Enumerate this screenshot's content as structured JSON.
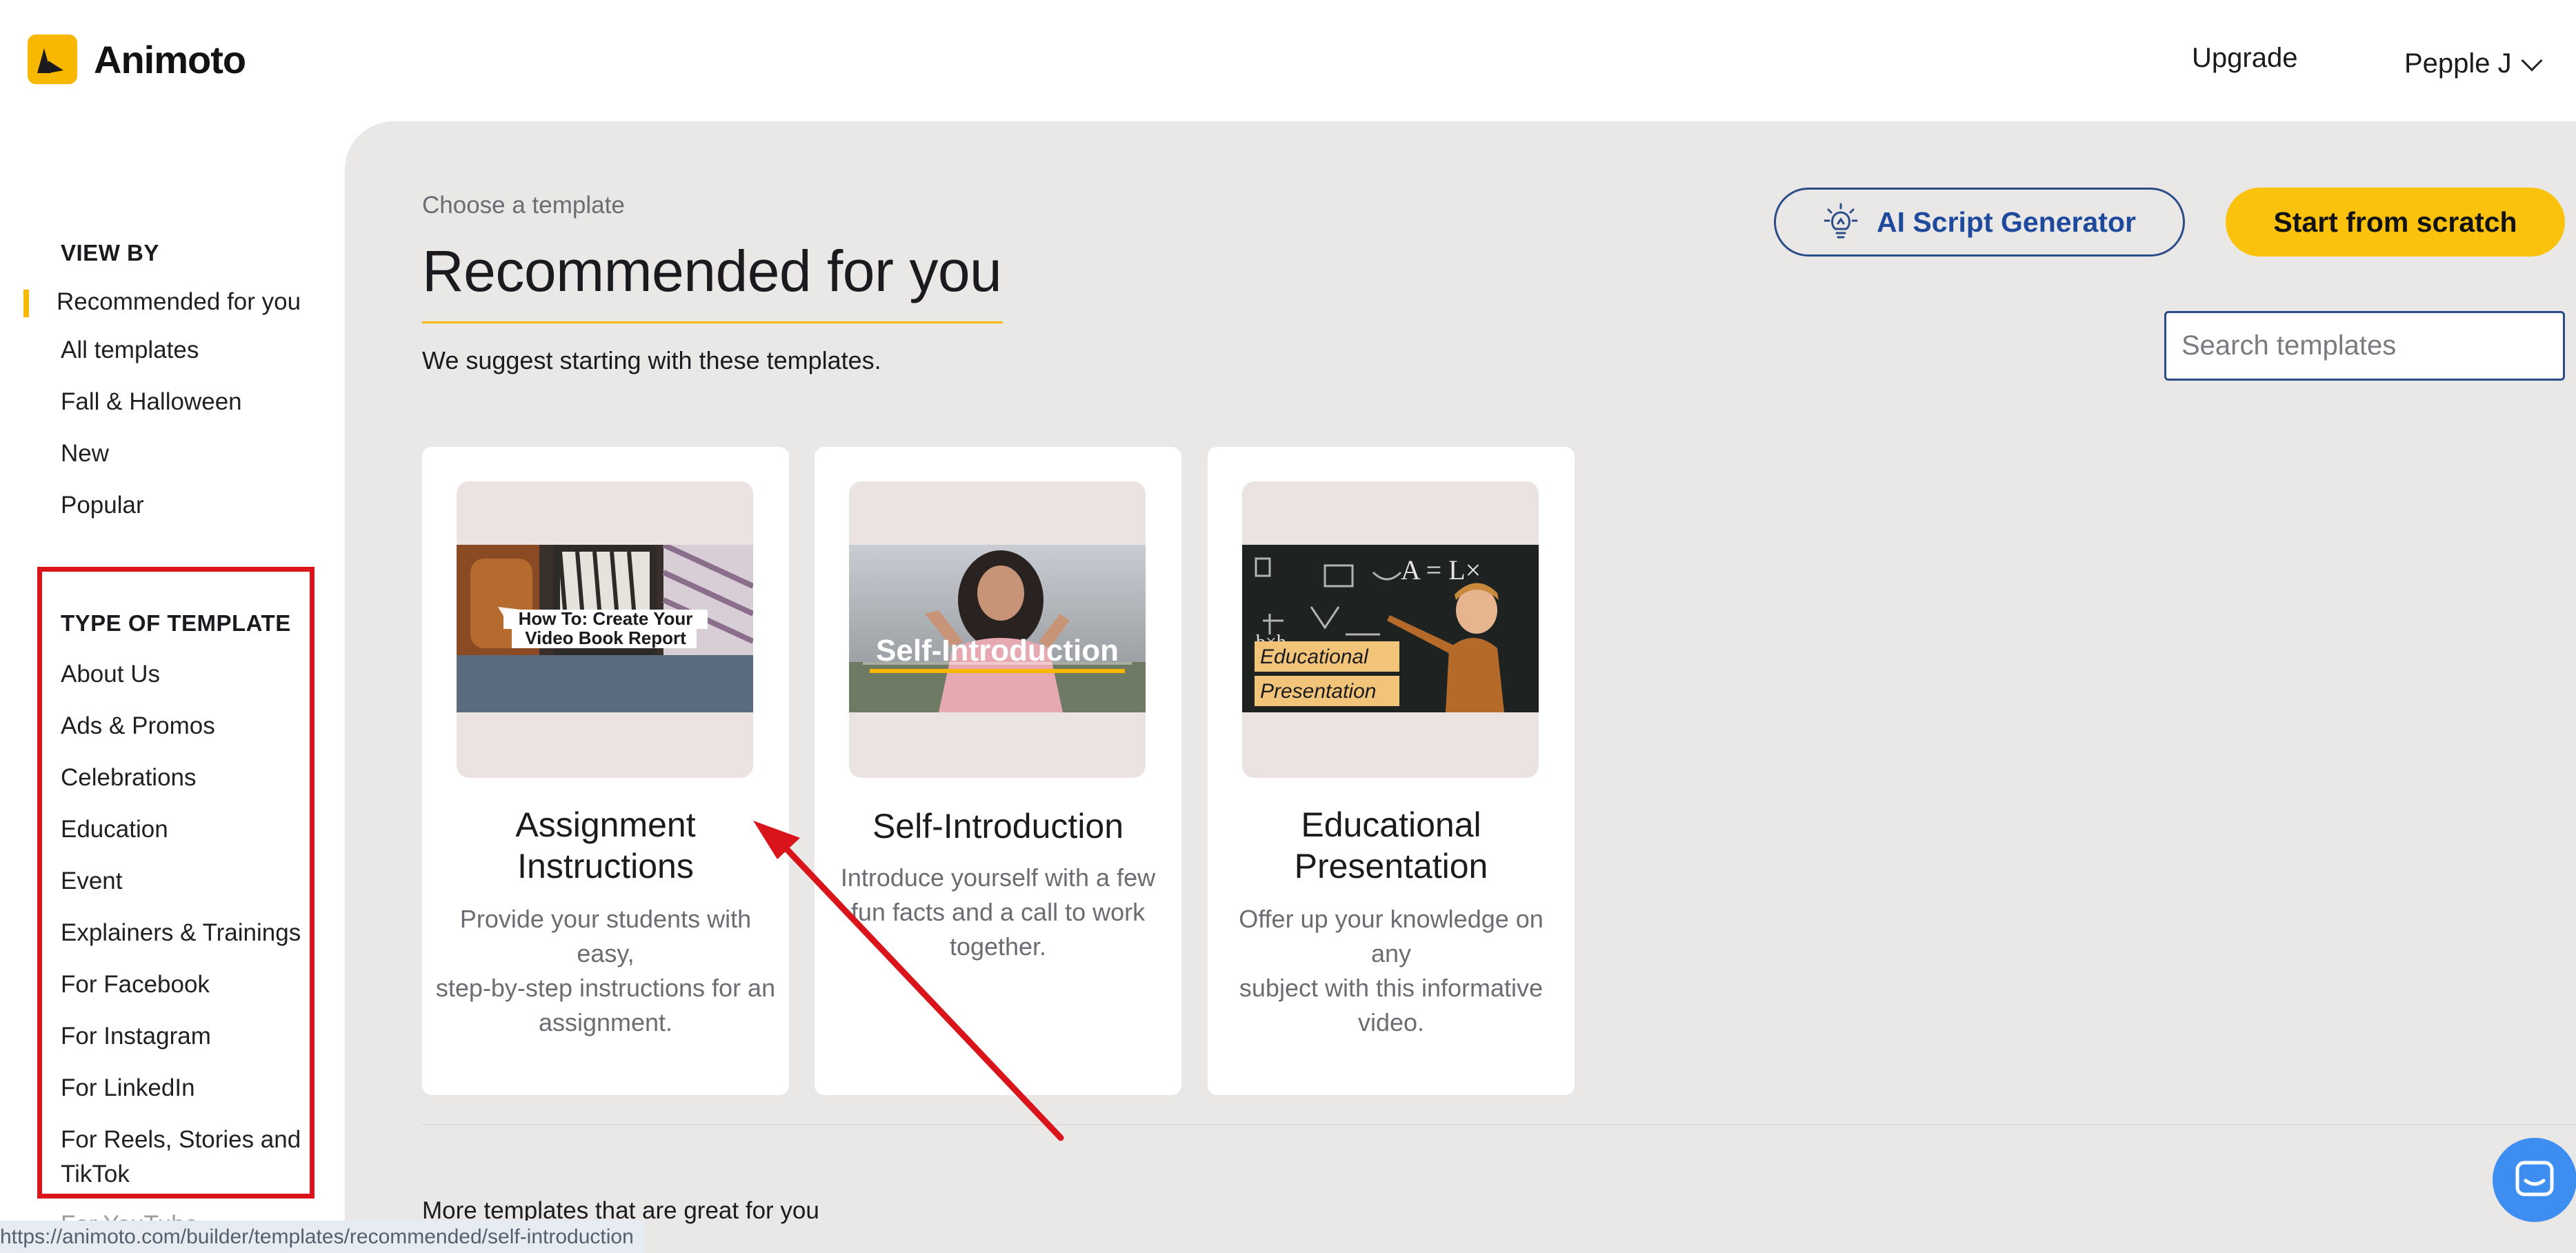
{
  "header": {
    "brand": "Animoto",
    "upgrade_label": "Upgrade",
    "user_name": "Pepple J"
  },
  "sidebar": {
    "view_heading": "VIEW BY",
    "view_items": [
      {
        "label": "Recommended for you",
        "active": true
      },
      {
        "label": "All templates"
      },
      {
        "label": "Fall & Halloween"
      },
      {
        "label": "New"
      },
      {
        "label": "Popular"
      }
    ],
    "type_heading": "TYPE OF TEMPLATE",
    "type_items": [
      {
        "label": "About Us"
      },
      {
        "label": "Ads & Promos"
      },
      {
        "label": "Celebrations"
      },
      {
        "label": "Education"
      },
      {
        "label": "Event"
      },
      {
        "label": "Explainers & Trainings"
      },
      {
        "label": "For Facebook"
      },
      {
        "label": "For Instagram"
      },
      {
        "label": "For LinkedIn"
      },
      {
        "label": "For Reels, Stories and"
      },
      {
        "label": "TikTok"
      },
      {
        "label": "For YouTube"
      }
    ]
  },
  "main": {
    "subtitle": "Choose a template",
    "title": "Recommended for you",
    "suggest_text": "We suggest starting with these templates.",
    "ai_button_label": "AI Script Generator",
    "scratch_button_label": "Start from scratch",
    "search_placeholder": "Search templates",
    "more_heading": "More templates that are great for you"
  },
  "cards": [
    {
      "overlay_line1": "How To: Create Your",
      "overlay_line2": "Video Book Report",
      "title_line1": "Assignment",
      "title_line2": "Instructions",
      "desc_line1": "Provide your students with easy,",
      "desc_line2": "step-by-step instructions for an",
      "desc_line3": "assignment."
    },
    {
      "overlay_line1": "Self-Introduction",
      "title_line1": "Self-Introduction",
      "desc_line1": "Introduce yourself with a few",
      "desc_line2": "fun facts and a call to work",
      "desc_line3": "together."
    },
    {
      "overlay_line1": "Educational",
      "overlay_line2": "Presentation",
      "title_line1": "Educational",
      "title_line2": "Presentation",
      "desc_line1": "Offer up your knowledge on any",
      "desc_line2": "subject with this informative",
      "desc_line3": "video."
    }
  ],
  "status_bar": {
    "url": "https://animoto.com/builder/templates/recommended/self-introduction"
  },
  "colors": {
    "accent_yellow": "#fbc20d",
    "annotation_red": "#d9151b",
    "ai_blue": "#1f4a9c",
    "panel_gray": "#e9e8e7"
  },
  "icons": [
    "animoto-logo-icon",
    "chevron-down-icon",
    "lightbulb-icon",
    "chat-bubble-icon"
  ]
}
